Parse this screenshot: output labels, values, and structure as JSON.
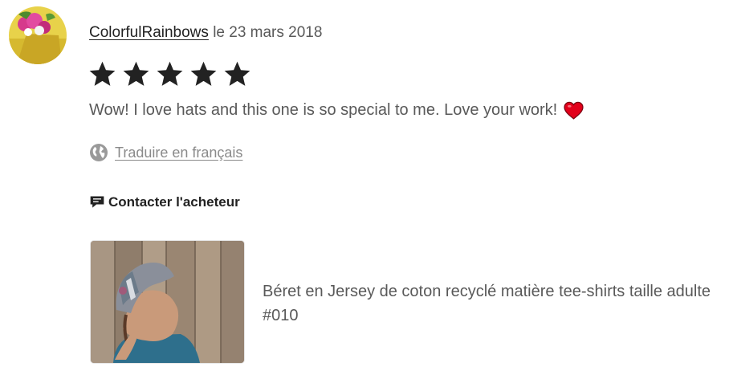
{
  "review": {
    "reviewer_name": "ColorfulRainbows",
    "date_text": "le 23 mars 2018",
    "rating": 5,
    "max_rating": 5,
    "text": "Wow! I love hats and this one is so special to me. Love your work!",
    "emoji_icon": "red-heart-icon"
  },
  "translate": {
    "icon": "globe-icon",
    "label": "Traduire en français"
  },
  "contact": {
    "icon": "message-icon",
    "label": "Contacter l'acheteur"
  },
  "listing": {
    "title": "Béret en Jersey de coton recyclé matière tee-shirts taille adulte #010"
  },
  "colors": {
    "star": "#222222",
    "heart": "#e2001a",
    "text": "#595959",
    "link_muted": "#8a8a8a"
  }
}
